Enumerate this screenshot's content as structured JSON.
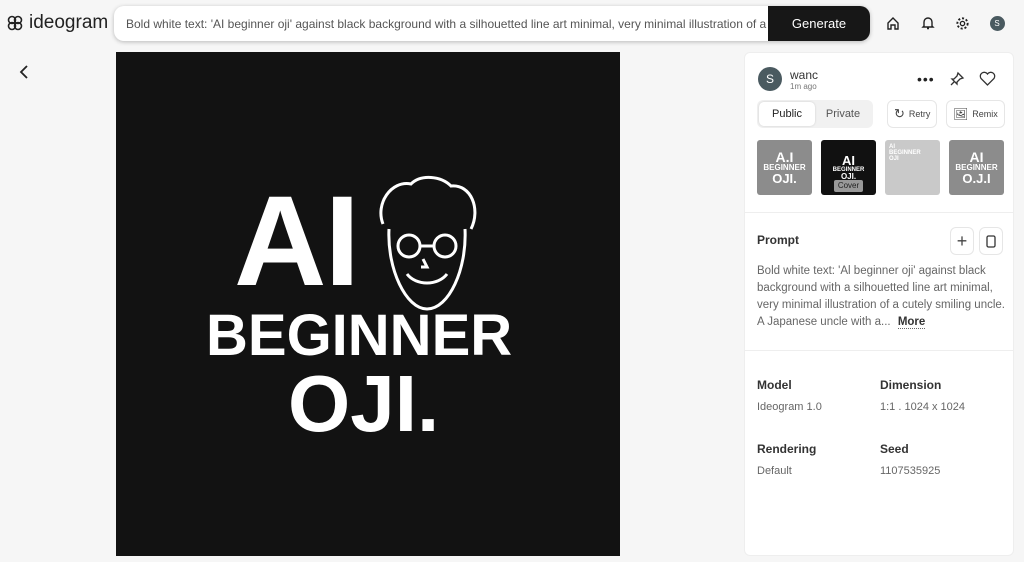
{
  "header": {
    "logo": "ideogram",
    "prompt_value": "Bold white text: 'AI beginner oji' against black background with a silhouetted line art minimal, very minimal illustration of a cutely smiling uncle.",
    "generate_label": "Generate",
    "avatar_initial": "S",
    "icons": [
      "home-icon",
      "bell-icon",
      "gear-icon",
      "avatar"
    ]
  },
  "image": {
    "line1": "AI",
    "line2": "BEGINNER",
    "line3": "OJI."
  },
  "panel": {
    "user": {
      "initial": "S",
      "name": "wanc",
      "time": "1m ago"
    },
    "visibility": {
      "options": [
        "Public",
        "Private"
      ],
      "selected": "Public"
    },
    "retry_label": "Retry",
    "remix_label": "Remix",
    "thumbnails": [
      {
        "top": "A.I",
        "mid": "BEGINNER",
        "bot": "OJI."
      },
      {
        "top": "AI",
        "mid": "BEGINNER",
        "bot": "OJI.",
        "badge": "Cover"
      },
      {
        "top": "AI",
        "mid": "BEGINNER",
        "bot": "OJI"
      },
      {
        "top": "AI",
        "mid": "BEGINNER",
        "bot": "O.J.I"
      }
    ],
    "prompt_title": "Prompt",
    "prompt_text": "Bold white text: 'Al beginner oji' against black background with a silhouetted line art minimal, very minimal illustration of a cutely smiling uncle. A Japanese uncle with a...",
    "more_label": "More",
    "details": [
      {
        "label": "Model",
        "value": "Ideogram 1.0"
      },
      {
        "label": "Dimension",
        "value": "1:1 . 1024 x 1024"
      },
      {
        "label": "Rendering",
        "value": "Default"
      },
      {
        "label": "Seed",
        "value": "1107535925"
      }
    ]
  }
}
